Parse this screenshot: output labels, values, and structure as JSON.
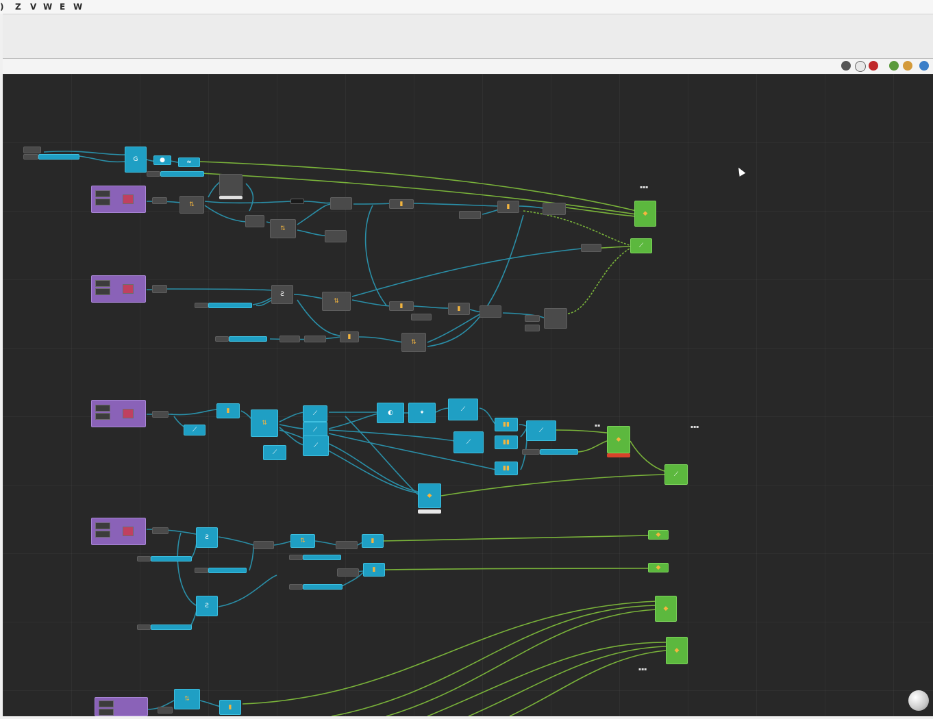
{
  "menu": {
    "items": [
      "Z",
      "V",
      "W",
      "E",
      "W"
    ]
  },
  "toolbar": {
    "icons": [
      "render-icon",
      "wireframe-icon",
      "material-icon",
      "preview-icon",
      "shaded-icon",
      "globe-icon"
    ]
  },
  "colors": {
    "canvas": "#282828",
    "wire_cyan": "#2a8fa8",
    "wire_green": "#7ab43a",
    "node_cyan": "#1f9fc4",
    "node_green": "#5cb83e",
    "node_purple": "#8a62b8",
    "node_dark": "#4a4a4a"
  }
}
